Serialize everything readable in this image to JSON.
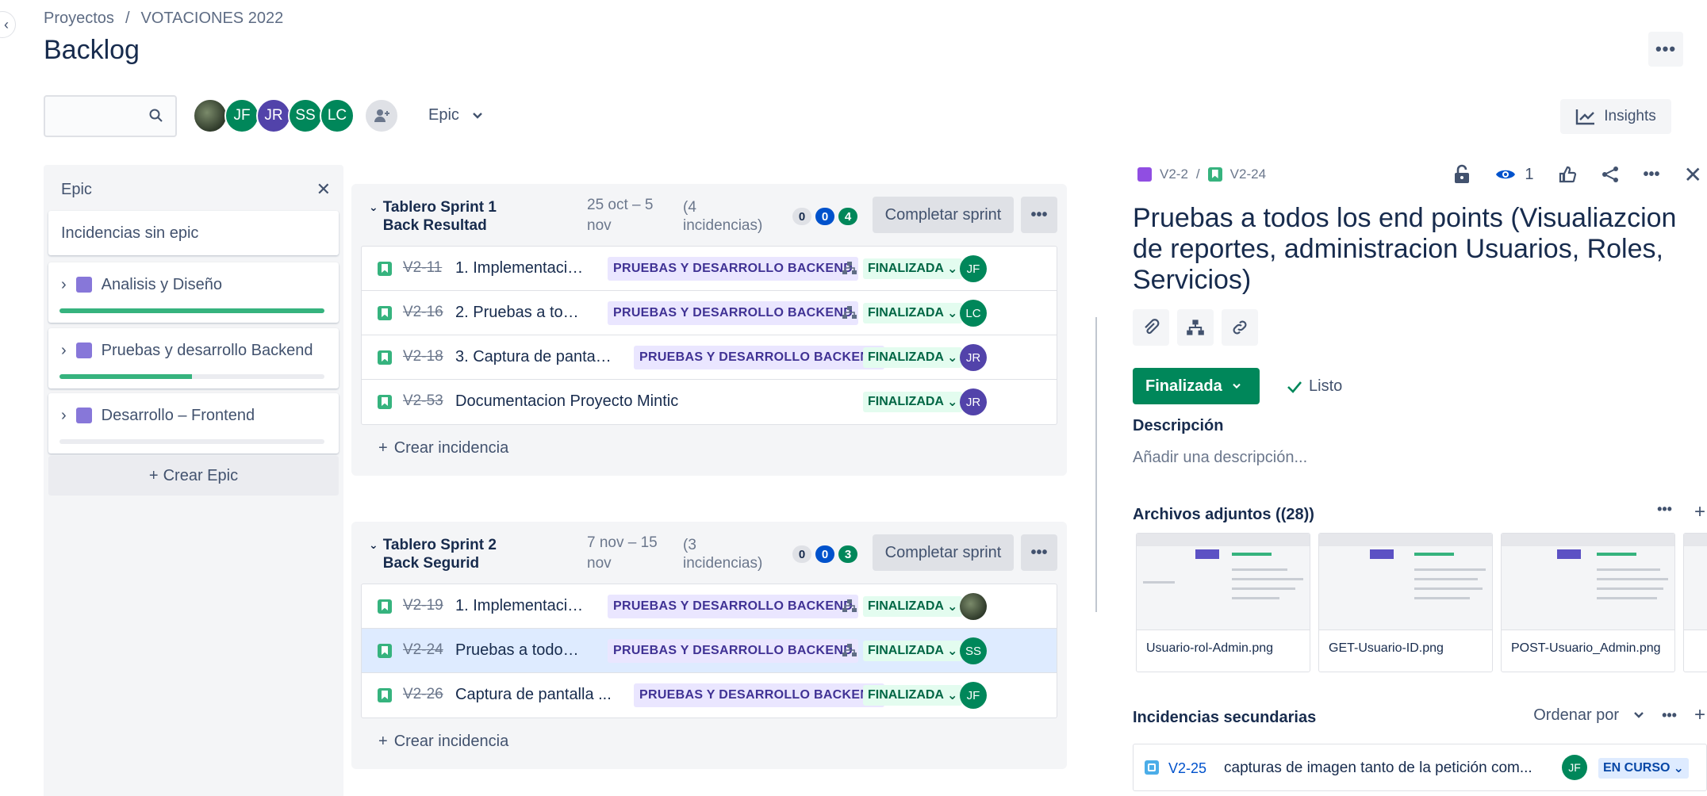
{
  "breadcrumb": {
    "projects": "Proyectos",
    "separator": "/",
    "project": "VOTACIONES 2022"
  },
  "page": {
    "title": "Backlog",
    "more": "•••"
  },
  "toolbar": {
    "search_placeholder": "",
    "avatars": [
      "JF",
      "JR",
      "SS",
      "LC"
    ],
    "epic_filter": "Epic",
    "insights": "Insights"
  },
  "epic_panel": {
    "title": "Epic",
    "no_epic": "Incidencias sin epic",
    "epics": [
      {
        "name": "Analisis y Diseño",
        "progress": 1.0
      },
      {
        "name": "Pruebas y desarrollo Backend",
        "progress": 0.5
      },
      {
        "name": "Desarrollo – Frontend",
        "progress": 0.0
      }
    ],
    "create_epic": "Crear Epic"
  },
  "colors": {
    "done_green": "#36b37e",
    "epic_purple": "#8777d9",
    "selected_row": "#deebff",
    "primary_blue": "#0052cc"
  },
  "sprints": [
    {
      "title": "Tablero Sprint 1 Back Resultad",
      "dates": "25 oct – 5 nov",
      "count": "(4 incidencias)",
      "lozenges": [
        "0",
        "0",
        "4"
      ],
      "complete": "Completar sprint",
      "issues": [
        {
          "key": "V2-11",
          "summary": "1. Implementació...",
          "epic": "PRUEBAS Y DESARROLLO BACKEND",
          "status": "FINALIZADA",
          "assignee": "JF",
          "color": "#00875a"
        },
        {
          "key": "V2-16",
          "summary": "2. Pruebas a todo...",
          "epic": "PRUEBAS Y DESARROLLO BACKEND",
          "status": "FINALIZADA",
          "assignee": "LC",
          "color": "#00875a"
        },
        {
          "key": "V2-18",
          "summary": "3. Captura de pantall...",
          "epic": "PRUEBAS Y DESARROLLO BACKEND",
          "status": "FINALIZADA",
          "assignee": "JR",
          "color": "#5243aa"
        },
        {
          "key": "V2-53",
          "summary": "Documentacion Proyecto Mintic",
          "epic": "",
          "status": "FINALIZADA",
          "assignee": "JR",
          "color": "#5243aa"
        }
      ],
      "create_issue": "Crear incidencia"
    },
    {
      "title": "Tablero Sprint 2 Back Segurid",
      "dates": "7 nov – 15 nov",
      "count": "(3 incidencias)",
      "lozenges": [
        "0",
        "0",
        "3"
      ],
      "complete": "Completar sprint",
      "issues": [
        {
          "key": "V2-19",
          "summary": "1. Implementació...",
          "epic": "PRUEBAS Y DESARROLLO BACKEND",
          "status": "FINALIZADA",
          "assignee": "",
          "color": "photo"
        },
        {
          "key": "V2-24",
          "summary": "Pruebas a todos l...",
          "epic": "PRUEBAS Y DESARROLLO BACKEND",
          "status": "FINALIZADA",
          "assignee": "SS",
          "color": "#00875a"
        },
        {
          "key": "V2-26",
          "summary": "Captura de pantalla ...",
          "epic": "PRUEBAS Y DESARROLLO BACKEND",
          "status": "FINALIZADA",
          "assignee": "JF",
          "color": "#00875a"
        }
      ],
      "create_issue": "Crear incidencia"
    }
  ],
  "detail": {
    "parent_key": "V2-2",
    "separator": "/",
    "key": "V2-24",
    "watchers": "1",
    "title": "Pruebas a todos los end points (Visualiazcion de reportes, administracion Usuarios, Roles, Servicios)",
    "status": "Finalizada",
    "resolution": "Listo",
    "description_heading": "Descripción",
    "description_placeholder": "Añadir una descripción...",
    "attachments_heading": "Archivos adjuntos ((28))",
    "attachments": [
      "Usuario-rol-Admin.png",
      "GET-Usuario-ID.png",
      "POST-Usuario_Admin.png"
    ],
    "subtasks_heading": "Incidencias secundarias",
    "order_by": "Ordenar por",
    "subtask": {
      "key": "V2-25",
      "summary": "capturas de imagen tanto de la petición com...",
      "assignee": "JF",
      "status": "EN CURSO"
    }
  }
}
